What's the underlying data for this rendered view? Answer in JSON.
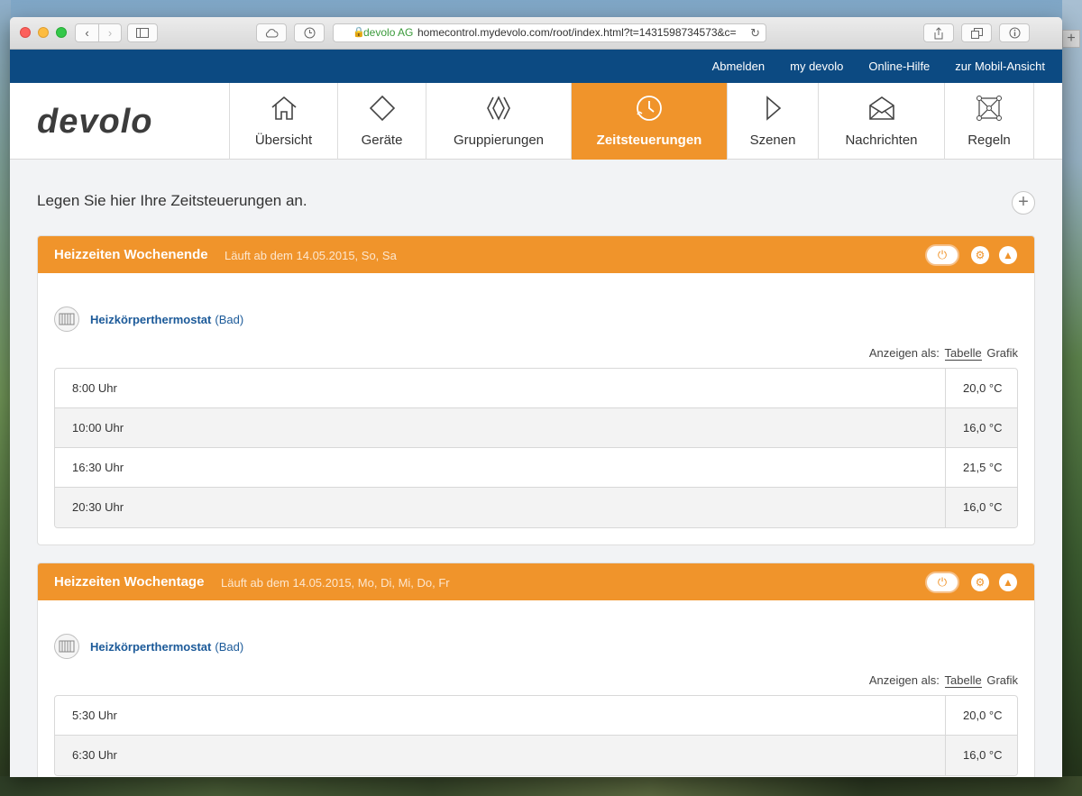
{
  "browser": {
    "url_org": "devolo AG",
    "url": "homecontrol.mydevolo.com/root/index.html?t=1431598734573&c=",
    "reload_icon": "reload-icon",
    "back_icon": "chevron-left-icon",
    "forward_icon": "chevron-right-icon"
  },
  "topbar": {
    "links": [
      "Abmelden",
      "my devolo",
      "Online-Hilfe",
      "zur Mobil-Ansicht"
    ]
  },
  "logo": "devolo",
  "nav": {
    "items": [
      {
        "label": "Übersicht",
        "icon": "house-icon"
      },
      {
        "label": "Geräte",
        "icon": "diamond-icon"
      },
      {
        "label": "Gruppierungen",
        "icon": "groups-icon"
      },
      {
        "label": "Zeitsteuerungen",
        "icon": "clock-icon",
        "active": true
      },
      {
        "label": "Szenen",
        "icon": "play-icon"
      },
      {
        "label": "Nachrichten",
        "icon": "envelope-icon"
      },
      {
        "label": "Regeln",
        "icon": "network-icon"
      }
    ]
  },
  "content": {
    "intro": "Legen Sie hier Ihre Zeitsteuerungen an.",
    "add_icon": "plus-icon"
  },
  "schedules": [
    {
      "title": "Heizzeiten Wochenende",
      "subtitle": "Läuft ab dem 14.05.2015, So, Sa",
      "device": "Heizkörperthermostat",
      "room": "(Bad)",
      "view_label": "Anzeigen als:",
      "view_table": "Tabelle",
      "view_graph": "Grafik",
      "rows": [
        {
          "time": "8:00 Uhr",
          "temp": "20,0 °C"
        },
        {
          "time": "10:00 Uhr",
          "temp": "16,0 °C"
        },
        {
          "time": "16:30 Uhr",
          "temp": "21,5 °C"
        },
        {
          "time": "20:30 Uhr",
          "temp": "16,0 °C"
        }
      ]
    },
    {
      "title": "Heizzeiten Wochentage",
      "subtitle": "Läuft ab dem 14.05.2015, Mo, Di, Mi, Do, Fr",
      "device": "Heizkörperthermostat",
      "room": "(Bad)",
      "view_label": "Anzeigen als:",
      "view_table": "Tabelle",
      "view_graph": "Grafik",
      "rows": [
        {
          "time": "5:30 Uhr",
          "temp": "20,0 °C"
        },
        {
          "time": "6:30 Uhr",
          "temp": "16,0 °C"
        }
      ]
    }
  ],
  "colors": {
    "brand_blue": "#0c4a82",
    "accent_orange": "#f0942b",
    "link_blue": "#1c5a99"
  }
}
